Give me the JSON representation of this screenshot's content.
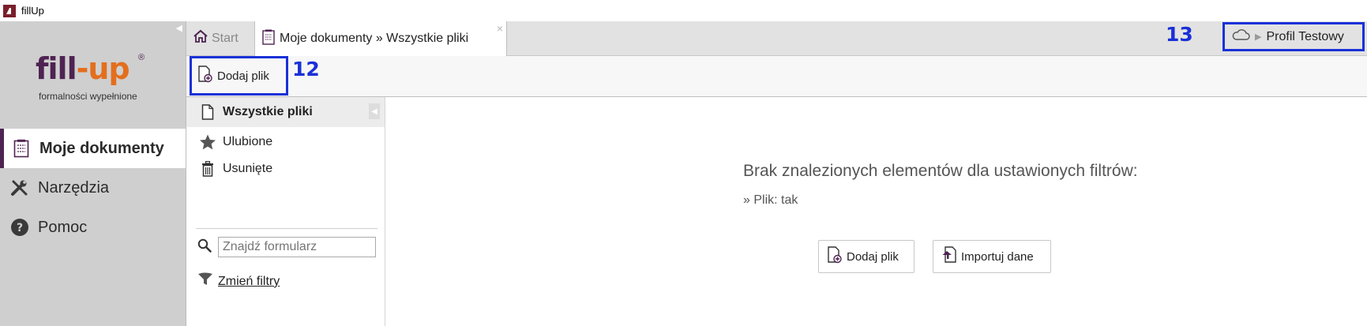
{
  "window": {
    "title": "fillUp"
  },
  "logo": {
    "brand_part1": "fill",
    "brand_part2": "-up",
    "registered": "®",
    "tagline": "formalności wypełnione"
  },
  "sidebar": {
    "items": [
      {
        "label": "Moje dokumenty",
        "icon": "document-list-icon",
        "active": true
      },
      {
        "label": "Narzędzia",
        "icon": "tools-icon",
        "active": false
      },
      {
        "label": "Pomoc",
        "icon": "help-icon",
        "active": false
      }
    ]
  },
  "tabs": {
    "start": {
      "label": "Start",
      "icon": "home-icon"
    },
    "active": {
      "label": "Moje dokumenty » Wszystkie pliki",
      "icon": "document-list-icon",
      "close": "×"
    }
  },
  "markers": {
    "toolbar": "12",
    "profile": "13"
  },
  "profile": {
    "label": "Profil Testowy",
    "icon": "cloud-icon",
    "separator": "▶"
  },
  "toolbar": {
    "add_file_label": "Dodaj plik"
  },
  "filters": {
    "items": [
      {
        "label": "Wszystkie pliki",
        "icon": "file-icon",
        "active": true
      },
      {
        "label": "Ulubione",
        "icon": "star-icon",
        "active": false
      },
      {
        "label": "Usunięte",
        "icon": "trash-icon",
        "active": false
      }
    ],
    "search_placeholder": "Znajdź formularz",
    "change_filters_label": "Zmień filtry"
  },
  "main": {
    "empty_message": "Brak znalezionych elementów dla ustawionych filtrów:",
    "filter_note": "» Plik: tak",
    "add_file_label": "Dodaj plik",
    "import_label": "Importuj dane"
  },
  "colors": {
    "accent_purple": "#4e2352",
    "accent_orange": "#e36f1e",
    "annotation_blue": "#1a30d8"
  }
}
